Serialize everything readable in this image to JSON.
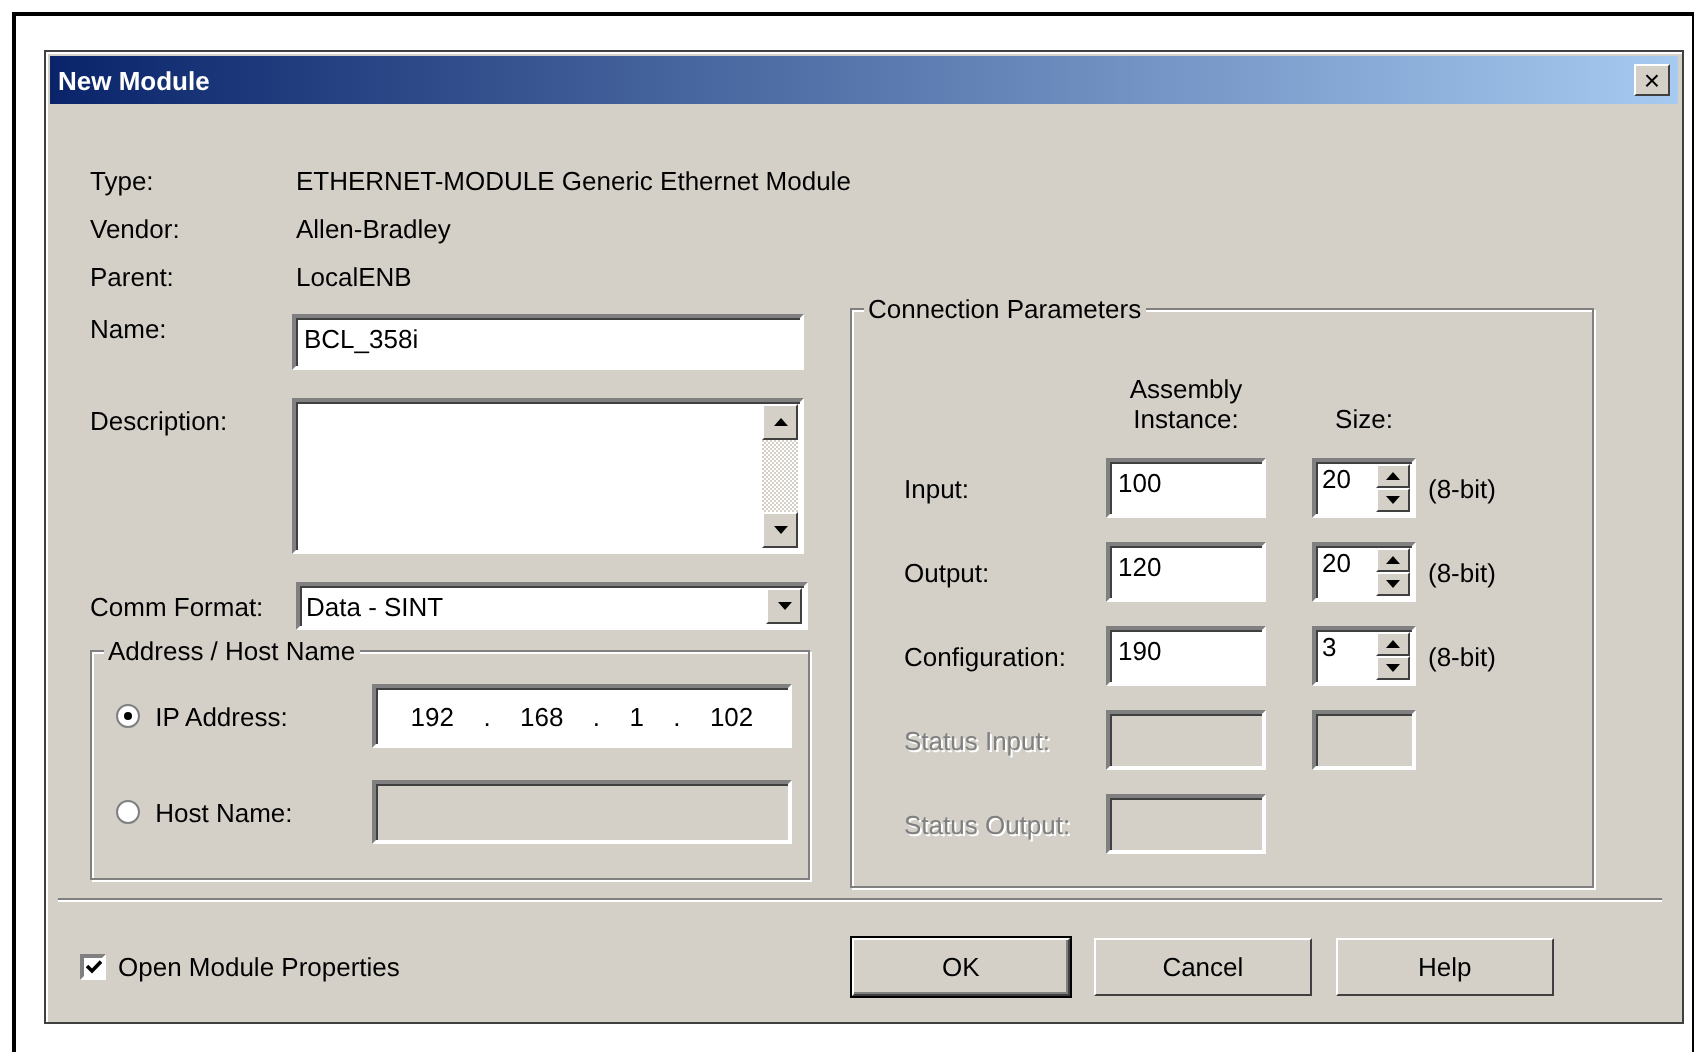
{
  "window": {
    "title": "New Module",
    "close": "×"
  },
  "info": [
    {
      "label": "Type:",
      "value": "ETHERNET-MODULE Generic Ethernet Module"
    },
    {
      "label": "Vendor:",
      "value": "Allen-Bradley"
    },
    {
      "label": "Parent:",
      "value": "LocalENB"
    }
  ],
  "name": {
    "label": "Name:",
    "value": "BCL_358i"
  },
  "description": {
    "label": "Description:"
  },
  "comm_format": {
    "label": "Comm Format:",
    "value": "Data - SINT"
  },
  "address": {
    "title": "Address / Host Name",
    "options": [
      {
        "label": "IP Address:",
        "selected": true,
        "ip_parts": [
          "192",
          ".",
          "168",
          ".",
          "1",
          ".",
          "102"
        ]
      },
      {
        "label": "Host Name:",
        "selected": false
      }
    ]
  },
  "connection": {
    "title": "Connection Parameters",
    "instance_header": "Assembly Instance:",
    "size_header": "Size:",
    "rows": [
      {
        "kind": "full",
        "label": "Input:",
        "instance": "100",
        "size": "20",
        "unit": "(8-bit)",
        "disabled": false
      },
      {
        "kind": "full",
        "label": "Output:",
        "instance": "120",
        "size": "20",
        "unit": "(8-bit)",
        "disabled": false
      },
      {
        "kind": "full",
        "label": "Configuration:",
        "instance": "190",
        "size": "3",
        "unit": "(8-bit)",
        "disabled": false
      },
      {
        "kind": "status_pair",
        "label": "Status Input:",
        "disabled": true
      },
      {
        "kind": "status_single",
        "label": "Status Output:",
        "disabled": true
      }
    ]
  },
  "open_properties": {
    "label": "Open Module Properties",
    "checked": true
  },
  "buttons": [
    {
      "label": "OK",
      "default": true
    },
    {
      "label": "Cancel",
      "default": false
    },
    {
      "label": "Help",
      "default": false
    }
  ]
}
